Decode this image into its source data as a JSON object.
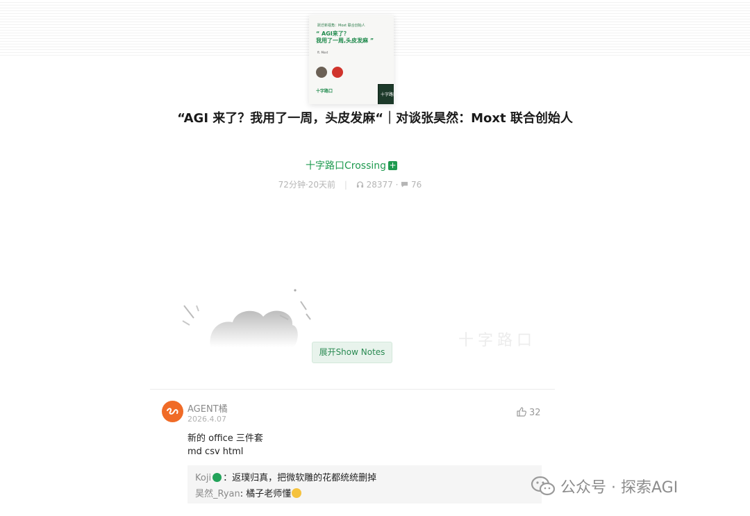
{
  "cover": {
    "top_line": "跃迁新视角：Moxt 联合创始人",
    "quote": "“ AGI来了？\n我用了一周,头皮发麻 ”",
    "small": "ft. Moxt",
    "brand": "十字路口",
    "logo_text": "十字路口"
  },
  "episode": {
    "title": "“AGI 来了？我用了一周，头皮发麻“｜对谈张昊然：Moxt 联合创始人",
    "channel": "十字路口Crossing",
    "channel_badge": "+",
    "duration_age": "72分钟·20天前",
    "listens": "28377",
    "comments": "76"
  },
  "faint_brand": "十字路口",
  "show_notes_label": "展开Show Notes",
  "comment": {
    "author": "AGENT橘",
    "date": "2026.4.07",
    "likes": "32",
    "line1": "新的 office 三件套",
    "line2": "md csv html",
    "replies": [
      {
        "who": "Koji",
        "text": "：返璞归真，把微软雕的花都统统删掉"
      },
      {
        "who": "昊然_Ryan",
        "text": ": 橘子老师懂"
      }
    ]
  },
  "watermark": "公众号 · 探索AGI"
}
